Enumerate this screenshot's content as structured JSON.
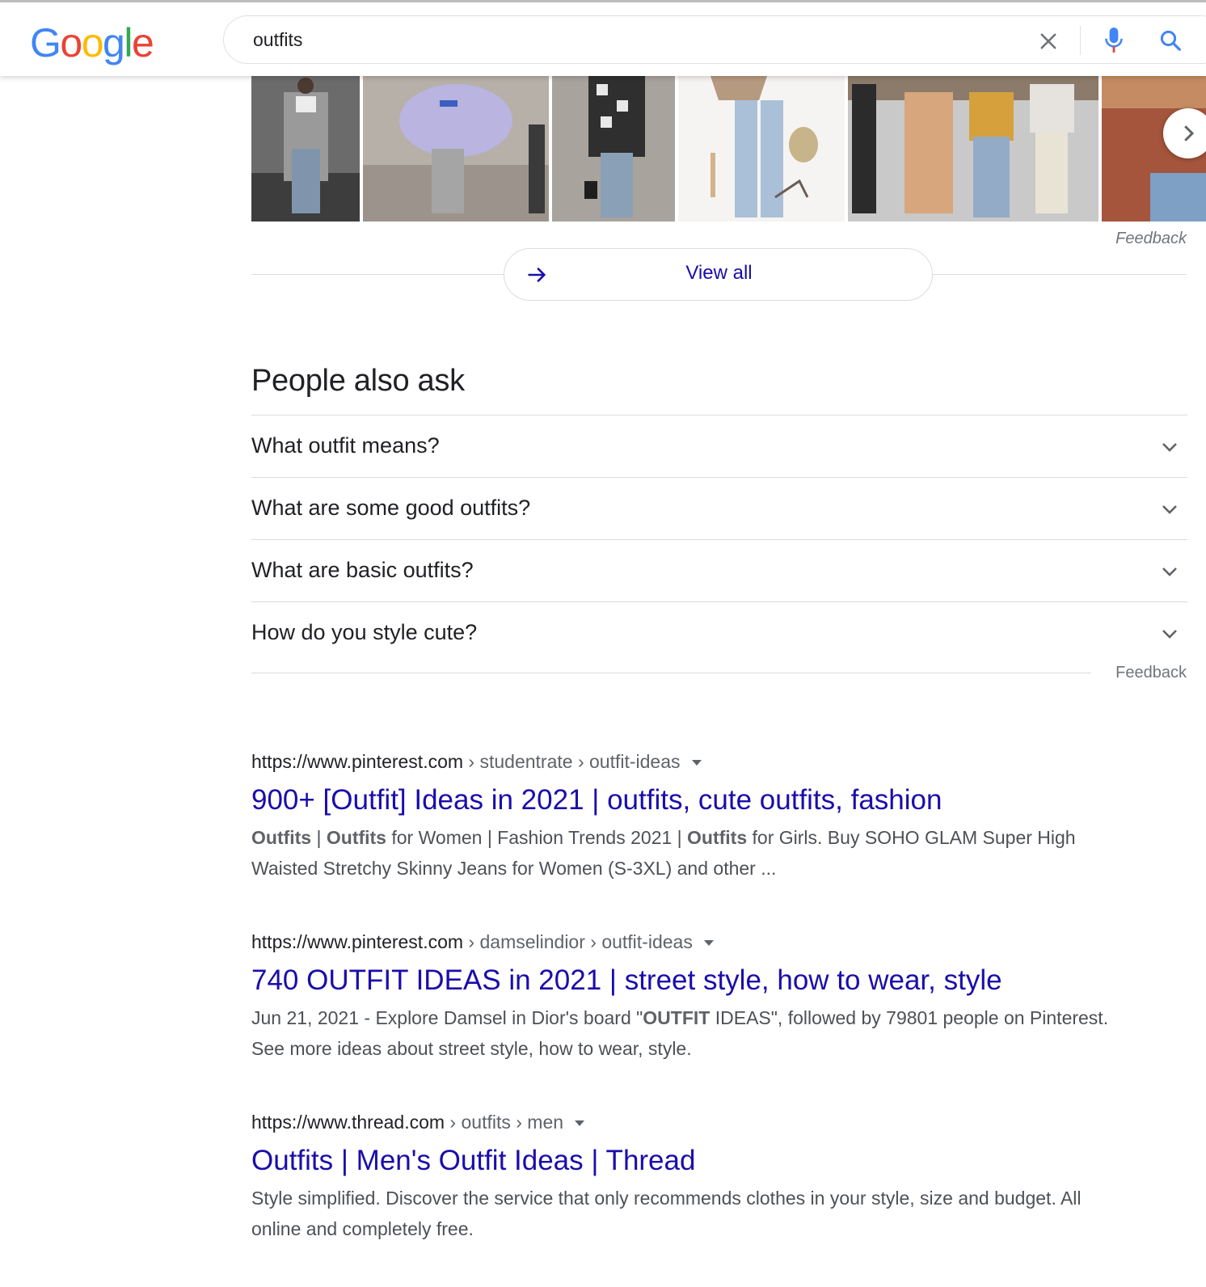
{
  "search": {
    "query": "outfits",
    "logo": [
      "G",
      "o",
      "o",
      "g",
      "l",
      "e"
    ],
    "logo_colors": [
      "#4285F4",
      "#EA4335",
      "#FBBC05",
      "#4285F4",
      "#34A853",
      "#EA4335"
    ]
  },
  "images": {
    "feedback_label": "Feedback",
    "view_all_label": "View all"
  },
  "paa": {
    "title": "People also ask",
    "questions": [
      "What outfit means?",
      "What are some good outfits?",
      "What are basic outfits?",
      "How do you style cute?"
    ],
    "feedback_label": "Feedback"
  },
  "results": [
    {
      "domain": "https://www.pinterest.com",
      "crumbs": " › studentrate › outfit-ideas",
      "title": "900+ [Outfit] Ideas in 2021 | outfits, cute outfits, fashion",
      "snippet": [
        {
          "text": "Outfits",
          "bold": true
        },
        {
          "text": " | ",
          "bold": false
        },
        {
          "text": "Outfits",
          "bold": true
        },
        {
          "text": " for Women | Fashion Trends 2021 | ",
          "bold": false
        },
        {
          "text": "Outfits",
          "bold": true
        },
        {
          "text": " for Girls. Buy SOHO GLAM Super High Waisted Stretchy Skinny Jeans for Women (S-3XL) and other ...",
          "bold": false
        }
      ]
    },
    {
      "domain": "https://www.pinterest.com",
      "crumbs": " › damselindior › outfit-ideas",
      "title": "740 OUTFIT IDEAS in 2021 | street style, how to wear, style",
      "snippet": [
        {
          "text": "Jun 21, 2021 - Explore Damsel in Dior's board \"",
          "bold": false
        },
        {
          "text": "OUTFIT",
          "bold": true
        },
        {
          "text": " IDEAS\", followed by 79801 people on Pinterest. See more ideas about street style, how to wear, style.",
          "bold": false
        }
      ]
    },
    {
      "domain": "https://www.thread.com",
      "crumbs": " › outfits › men",
      "title": "Outfits | Men's Outfit Ideas | Thread",
      "snippet": [
        {
          "text": "Style simplified. Discover the service that only recommends clothes in your style, size and budget. All online and completely free.",
          "bold": false
        }
      ]
    }
  ],
  "colors": {
    "link": "#1a0dab",
    "divider": "#dadce0",
    "muted": "#70757a",
    "mic_blue": "#4285F4",
    "mic_red": "#EA4335"
  }
}
